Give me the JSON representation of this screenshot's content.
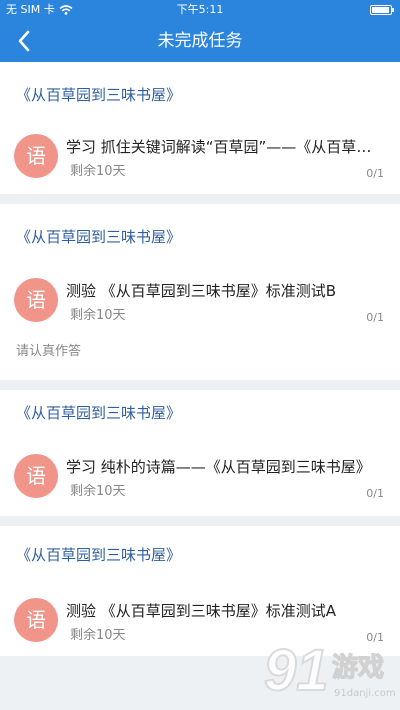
{
  "status_bar": {
    "carrier": "无 SIM 卡",
    "wifi_icon": "wifi-icon",
    "time": "下午5:11",
    "battery_icon": "battery-icon"
  },
  "nav": {
    "back_icon": "chevron-left-icon",
    "title": "未完成任务"
  },
  "cards": [
    {
      "title": "《从百草园到三味书屋》",
      "subject": "语",
      "task": "学习  抓住关键词解读“百草园”——《从百草园到三味书屋》",
      "remaining": "剩余10天",
      "count": "0/1",
      "note": ""
    },
    {
      "title": "《从百草园到三味书屋》",
      "subject": "语",
      "task": "测验  《从百草园到三味书屋》标准测试B",
      "remaining": "剩余10天",
      "count": "0/1",
      "note": "请认真作答"
    },
    {
      "title": "《从百草园到三味书屋》",
      "subject": "语",
      "task": "学习  纯朴的诗篇——《从百草园到三味书屋》",
      "remaining": "剩余10天",
      "count": "0/1",
      "note": ""
    },
    {
      "title": "《从百草园到三味书屋》",
      "subject": "语",
      "task": "测验  《从百草园到三味书屋》标准测试A",
      "remaining": "剩余10天",
      "count": "0/1",
      "note": ""
    }
  ],
  "watermark": {
    "text": "91游戏",
    "site": "91danji.com"
  },
  "colors": {
    "header": "#2b85dc",
    "card_title": "#2f5fa0",
    "subject_icon": "#f1948a",
    "background": "#eef1f4"
  }
}
